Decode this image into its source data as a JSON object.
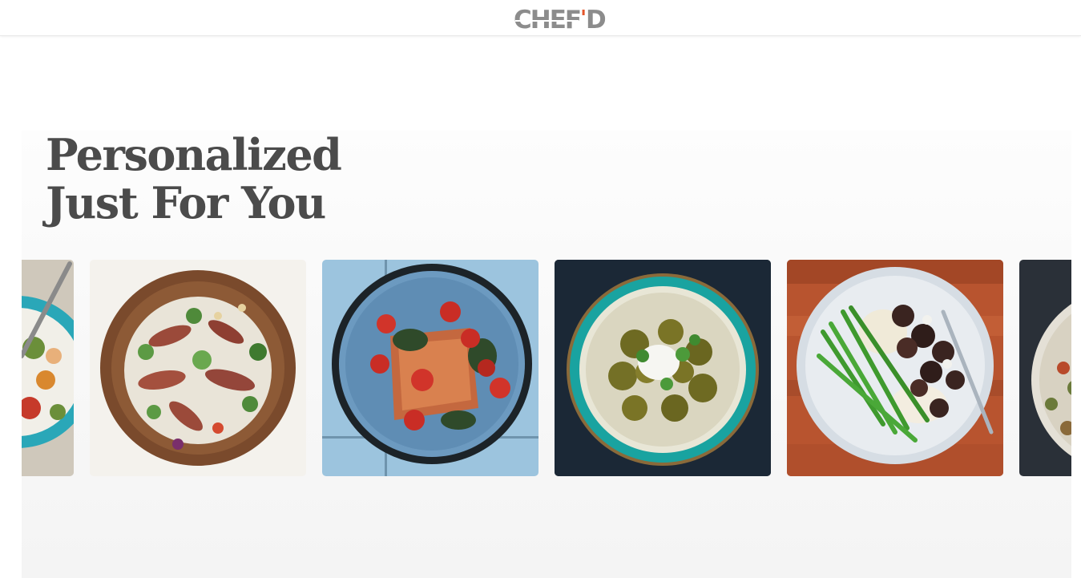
{
  "header": {
    "logo_text": "CHEF'D",
    "logo_main": "CHEF",
    "logo_apostrophe": "'",
    "logo_end": "D"
  },
  "hero": {
    "heading_line1": "Personalized",
    "heading_line2": "Just For You"
  },
  "carousel": {
    "items": [
      {
        "name": "okra shrimp bowl",
        "icon": "meal-photo"
      },
      {
        "name": "steak noodle salad",
        "icon": "meal-photo"
      },
      {
        "name": "salmon with tomatoes and spinach",
        "icon": "meal-photo"
      },
      {
        "name": "curry with rice",
        "icon": "meal-photo"
      },
      {
        "name": "beef with green beans and mash",
        "icon": "meal-photo"
      },
      {
        "name": "lentil bowl",
        "icon": "meal-photo"
      }
    ]
  },
  "colors": {
    "logo_gray": "#8c8c8c",
    "logo_accent": "#e4562b",
    "heading": "#4b4b4b",
    "section_bg": "#f7f7f7"
  }
}
